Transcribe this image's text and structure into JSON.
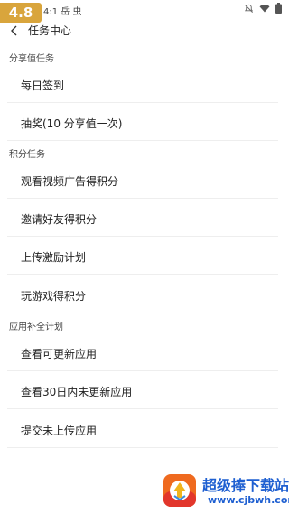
{
  "status_bar": {
    "version_badge": "4.8",
    "misc_text": "4:1  岳  虫"
  },
  "header": {
    "title": "任务中心"
  },
  "sections": [
    {
      "title": "分享值任务",
      "items": [
        {
          "label": "每日签到"
        },
        {
          "label": "抽奖(10 分享值一次)"
        }
      ]
    },
    {
      "title": "积分任务",
      "items": [
        {
          "label": "观看视频广告得积分"
        },
        {
          "label": "邀请好友得积分"
        },
        {
          "label": "上传激励计划"
        },
        {
          "label": "玩游戏得积分"
        }
      ]
    },
    {
      "title": "应用补全计划",
      "items": [
        {
          "label": "查看可更新应用"
        },
        {
          "label": "查看30日内未更新应用"
        },
        {
          "label": "提交未上传应用"
        }
      ]
    }
  ],
  "watermark": {
    "title": "超级捧下载站",
    "url": "www.cjbwh.com"
  },
  "colors": {
    "badge": "#d9a53c",
    "watermark_text": "#1e5fd1",
    "divider": "#eeeeee"
  }
}
